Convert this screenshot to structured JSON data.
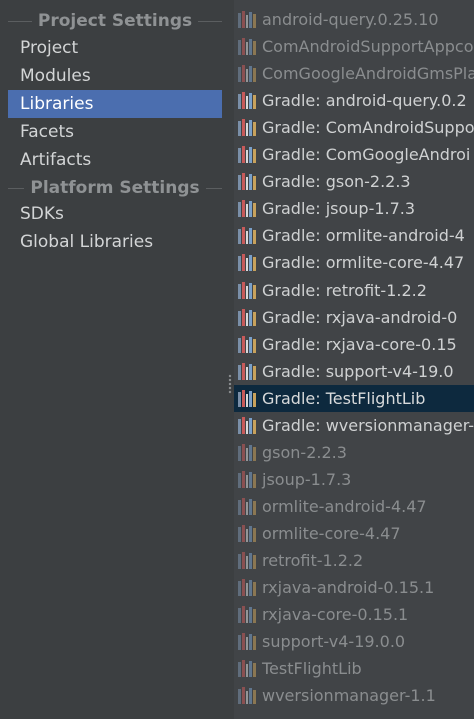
{
  "left_panel": {
    "project_settings_header": "Project Settings",
    "platform_settings_header": "Platform Settings",
    "project_items": [
      "Project",
      "Modules",
      "Libraries",
      "Facets",
      "Artifacts"
    ],
    "platform_items": [
      "SDKs",
      "Global Libraries"
    ],
    "selected_item": "Libraries"
  },
  "libraries": [
    {
      "label": "android-query.0.25.10",
      "kind": "plain"
    },
    {
      "label": "ComAndroidSupportAppco",
      "kind": "plain"
    },
    {
      "label": "ComGoogleAndroidGmsPla",
      "kind": "plain"
    },
    {
      "label": "Gradle: android-query.0.2",
      "kind": "gradle"
    },
    {
      "label": "Gradle: ComAndroidSuppo",
      "kind": "gradle"
    },
    {
      "label": "Gradle: ComGoogleAndroi",
      "kind": "gradle"
    },
    {
      "label": "Gradle: gson-2.2.3",
      "kind": "gradle"
    },
    {
      "label": "Gradle: jsoup-1.7.3",
      "kind": "gradle"
    },
    {
      "label": "Gradle: ormlite-android-4",
      "kind": "gradle"
    },
    {
      "label": "Gradle: ormlite-core-4.47",
      "kind": "gradle"
    },
    {
      "label": "Gradle: retrofit-1.2.2",
      "kind": "gradle"
    },
    {
      "label": "Gradle: rxjava-android-0",
      "kind": "gradle"
    },
    {
      "label": "Gradle: rxjava-core-0.15",
      "kind": "gradle"
    },
    {
      "label": "Gradle: support-v4-19.0",
      "kind": "gradle"
    },
    {
      "label": "Gradle: TestFlightLib",
      "kind": "gradle",
      "selected": true
    },
    {
      "label": "Gradle: wversionmanager-",
      "kind": "gradle"
    },
    {
      "label": "gson-2.2.3",
      "kind": "plain"
    },
    {
      "label": "jsoup-1.7.3",
      "kind": "plain"
    },
    {
      "label": "ormlite-android-4.47",
      "kind": "plain"
    },
    {
      "label": "ormlite-core-4.47",
      "kind": "plain"
    },
    {
      "label": "retrofit-1.2.2",
      "kind": "plain"
    },
    {
      "label": "rxjava-android-0.15.1",
      "kind": "plain"
    },
    {
      "label": "rxjava-core-0.15.1",
      "kind": "plain"
    },
    {
      "label": "support-v4-19.0.0",
      "kind": "plain"
    },
    {
      "label": "TestFlightLib",
      "kind": "plain"
    },
    {
      "label": "wversionmanager-1.1",
      "kind": "plain"
    }
  ],
  "colors": {
    "panel_background": "#3c3f41",
    "list_background": "#414447",
    "selection_left": "#4b6eaf",
    "selection_list": "#0d293e"
  },
  "icons": {
    "library": "library-icon"
  }
}
